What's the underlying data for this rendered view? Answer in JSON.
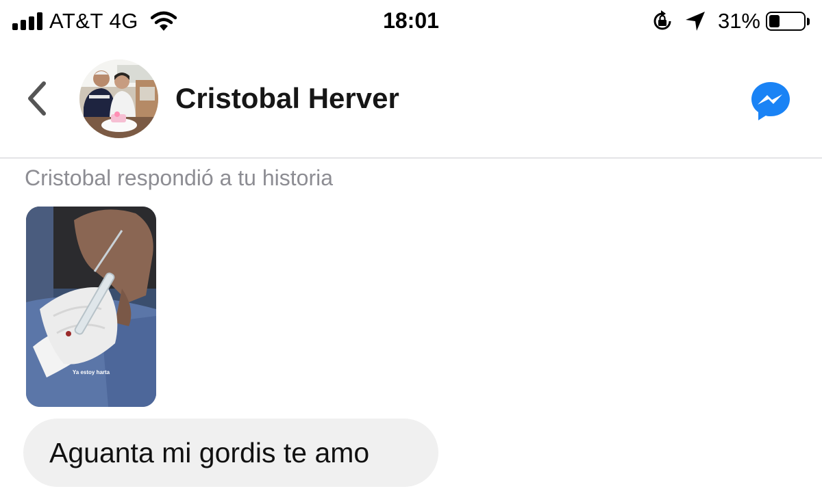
{
  "status_bar": {
    "signal_bars": 4,
    "carrier": "AT&T 4G",
    "time": "18:01",
    "battery_percent": "31%",
    "battery_level": 0.31,
    "icons": [
      "signal-icon",
      "wifi-icon",
      "rotation-lock-icon",
      "location-arrow-icon",
      "battery-icon"
    ]
  },
  "header": {
    "contact_name": "Cristobal Herver",
    "back_icon": "chevron-left-icon",
    "action_icon": "messenger-icon",
    "accent_color": "#1a83f5"
  },
  "conversation": {
    "story_reply_caption": "Cristobal respondió a tu historia",
    "story_overlay_text": "Ya estoy harta",
    "message_text": "Aguanta mi gordis te amo",
    "bubble_color": "#f0f0f0"
  }
}
